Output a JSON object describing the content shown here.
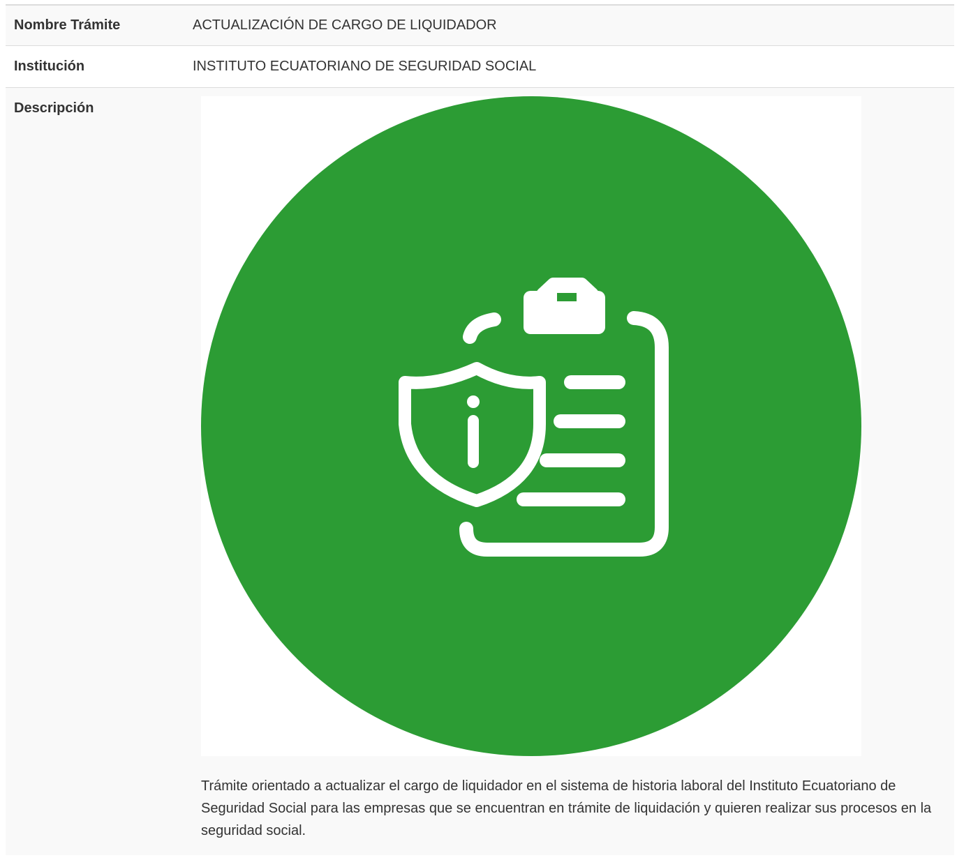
{
  "rows": {
    "nombre": {
      "label": "Nombre Trámite",
      "value": "ACTUALIZACIÓN DE CARGO DE LIQUIDADOR"
    },
    "institucion": {
      "label": "Institución",
      "value": "INSTITUTO ECUATORIANO DE SEGURIDAD SOCIAL"
    },
    "descripcion": {
      "label": "Descripción",
      "icon": "clipboard-shield-info-icon",
      "text": "Trámite orientado a actualizar el cargo de liquidador en el sistema de historia laboral del Instituto Ecuatoriano de Seguridad Social para las empresas que se encuentran en trámite de liquidación y quieren realizar sus procesos en la seguridad social."
    }
  },
  "colors": {
    "icon_circle": "#2c9c34",
    "icon_stroke": "#ffffff",
    "row_shade": "#f9f9f9",
    "border": "#dcdcdc",
    "text": "#333333"
  }
}
